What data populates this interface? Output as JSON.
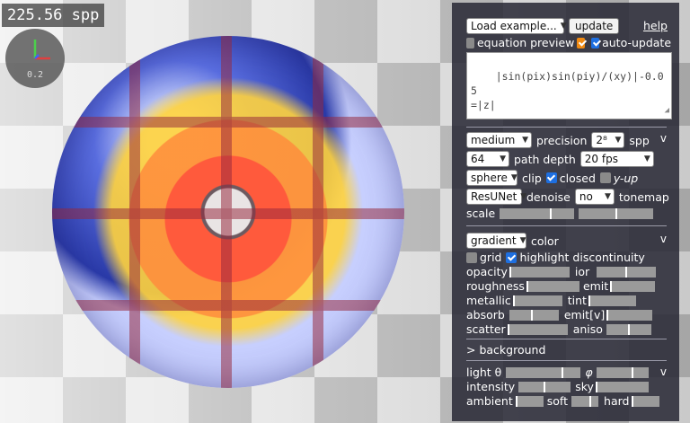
{
  "status": {
    "spp_readout": "225.56 spp"
  },
  "gizmo": {
    "zoom": "0.2"
  },
  "toolbar": {
    "example_select": "Load example...",
    "update_label": "update",
    "help_label": "help"
  },
  "options": {
    "equation_preview": {
      "label": "equation preview",
      "checked": true
    },
    "auto_update": {
      "label": "auto-update",
      "checked": true
    }
  },
  "equation": {
    "text": "|sin(pix)sin(piy)/(xy)|-0.05\n=|z|"
  },
  "render": {
    "quality_select": "medium",
    "precision_label": "precision",
    "spp_select": "2⁸",
    "spp_label": "spp",
    "collapse_icon": "v",
    "steps_select": "64",
    "path_depth_label": "path depth",
    "fps_select": "20 fps",
    "clip_select": "sphere",
    "clip_label": "clip",
    "closed": {
      "label": "closed",
      "checked": true
    },
    "y_up": {
      "label": "y-up",
      "checked": false
    },
    "denoise_select": "ResUNet",
    "denoise_label": "denoise",
    "tonemap_select": "no",
    "tonemap_label": "tonemap",
    "scale_label": "scale",
    "scale_value_1": 0.68,
    "scale_value_2": 0.5
  },
  "material": {
    "color_mode_select": "gradient",
    "color_label": "color",
    "collapse_icon": "v",
    "grid": {
      "label": "grid",
      "checked": false
    },
    "highlight_discontinuity": {
      "label": "highlight discontinuity",
      "checked": true
    },
    "sliders": [
      {
        "left_label": "opacity",
        "left_value": 0.0,
        "right_label": "ior",
        "right_value": 0.5
      },
      {
        "left_label": "roughness",
        "left_value": 0.0,
        "right_label": "emit",
        "right_value": 0.0
      },
      {
        "left_label": "metallic",
        "left_value": 0.0,
        "right_label": "tint",
        "right_value": 0.0
      },
      {
        "left_label": "absorb",
        "left_value": 0.45,
        "right_label": "emit[v]",
        "right_value": 0.0
      },
      {
        "left_label": "scatter",
        "left_value": 0.0,
        "right_label": "aniso",
        "right_value": 0.5
      }
    ]
  },
  "background": {
    "toggle_label": "> background"
  },
  "lighting": {
    "collapse_icon": "v",
    "light_theta_label": "light θ",
    "light_theta_value": 0.75,
    "phi_label": "φ",
    "phi_value": 0.7,
    "intensity_label": "intensity",
    "intensity_value": 0.5,
    "sky_label": "sky",
    "sky_value": 0.0,
    "ambient_label": "ambient",
    "ambient_value": 0.0,
    "soft_label": "soft",
    "soft_value": 0.7,
    "hard_label": "hard",
    "hard_value": 0.0
  },
  "colors": {
    "panel_bg": "#28283a",
    "checkbox_blue": "#1e6fe0",
    "checkbox_orange": "#f08a12"
  }
}
